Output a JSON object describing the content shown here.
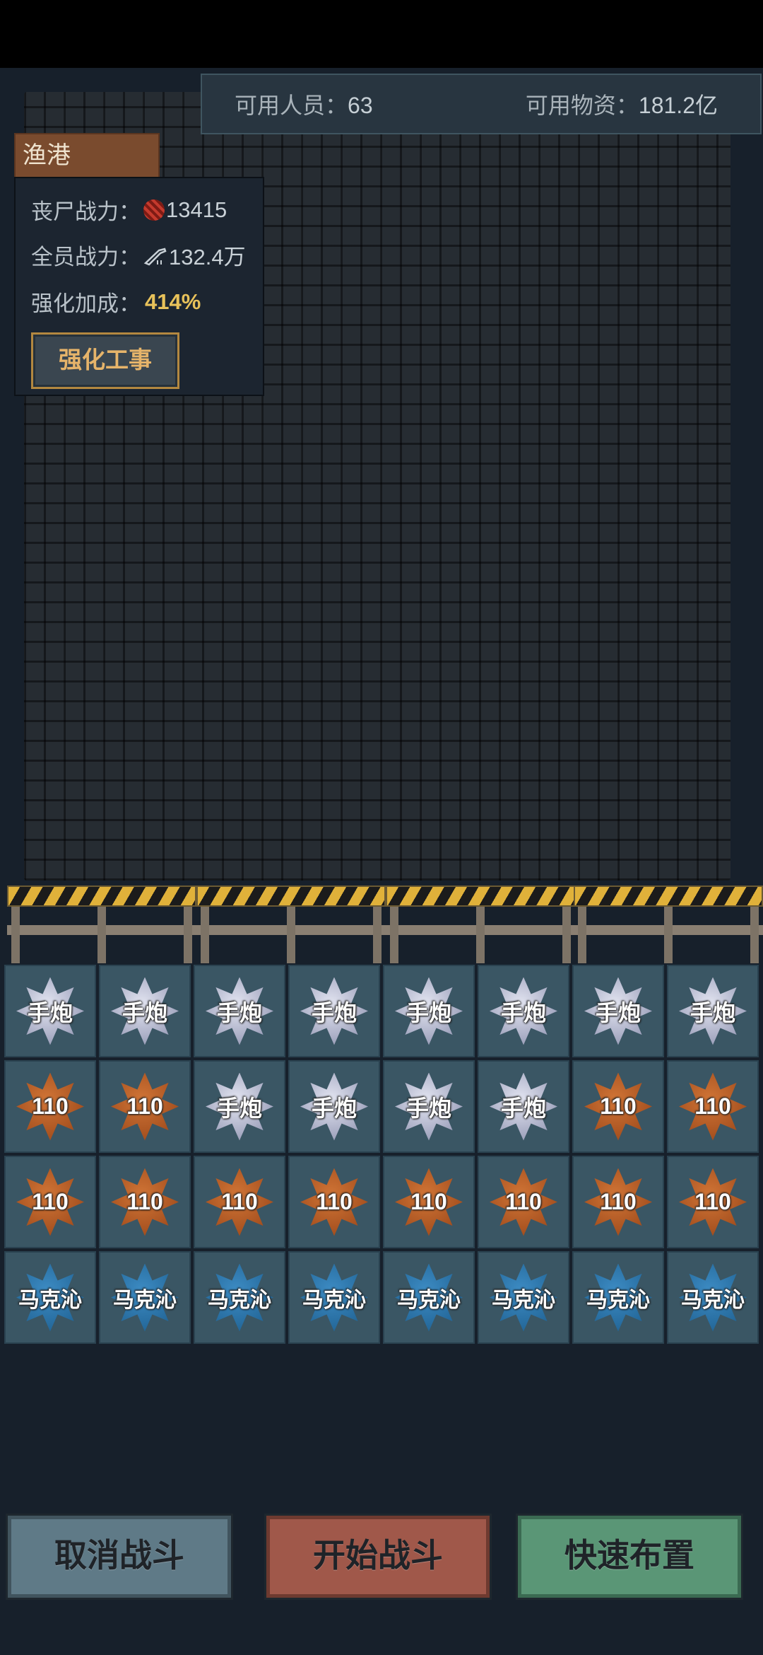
{
  "resources": {
    "personnel_label": "可用人员：",
    "personnel_value": "63",
    "supplies_label": "可用物资：",
    "supplies_value": "181.2亿"
  },
  "location": {
    "name": "渔港"
  },
  "info": {
    "zombie_power_label": "丧尸战力：",
    "zombie_power_value": "13415",
    "team_power_label": "全员战力：",
    "team_power_value": "132.4万",
    "bonus_label": "强化加成：",
    "bonus_value": "414%",
    "fortify_button": "强化工事"
  },
  "units": [
    [
      "手炮",
      "手炮",
      "手炮",
      "手炮",
      "手炮",
      "手炮",
      "手炮",
      "手炮"
    ],
    [
      "110",
      "110",
      "手炮",
      "手炮",
      "手炮",
      "手炮",
      "110",
      "110"
    ],
    [
      "110",
      "110",
      "110",
      "110",
      "110",
      "110",
      "110",
      "110"
    ],
    [
      "马克沁",
      "马克沁",
      "马克沁",
      "马克沁",
      "马克沁",
      "马克沁",
      "马克沁",
      "马克沁"
    ]
  ],
  "buttons": {
    "cancel": "取消战斗",
    "start": "开始战斗",
    "quick": "快速布置"
  }
}
